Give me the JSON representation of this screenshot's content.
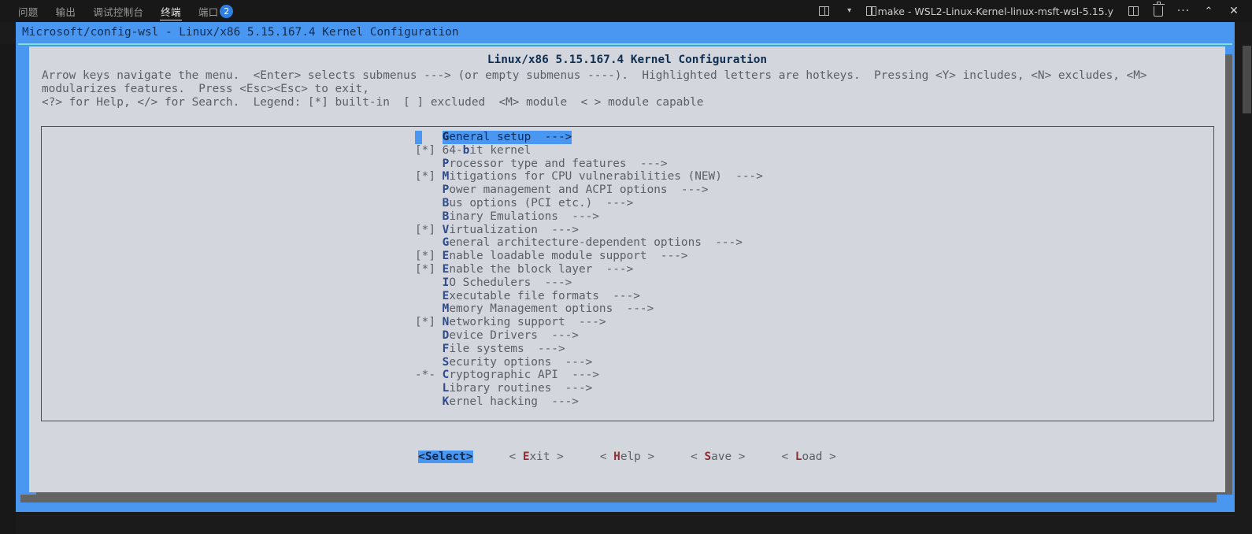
{
  "panel": {
    "tabs": [
      {
        "label": "问题",
        "name": "tab-problems",
        "active": false
      },
      {
        "label": "输出",
        "name": "tab-output",
        "active": false
      },
      {
        "label": "调试控制台",
        "name": "tab-debug-console",
        "active": false
      },
      {
        "label": "终端",
        "name": "tab-terminal",
        "active": true
      },
      {
        "label": "端口",
        "name": "tab-ports",
        "active": false
      }
    ],
    "ports_badge": "2",
    "terminal_name": "make - WSL2-Linux-Kernel-linux-msft-wsl-5.15.y",
    "actions": {
      "split_label": "",
      "chevron": "⌄",
      "dots": "···",
      "collapse": "⌃",
      "close": "✕"
    }
  },
  "dialog": {
    "window_title": "Microsoft/config-wsl - Linux/x86 5.15.167.4 Kernel Configuration",
    "heading": "Linux/x86 5.15.167.4 Kernel Configuration",
    "instructions": "Arrow keys navigate the menu.  <Enter> selects submenus ---> (or empty submenus ----).  Highlighted letters are hotkeys.  Pressing <Y> includes, <N> excludes, <M> modularizes features.  Press <Esc><Esc> to exit,\n<?> for Help, </> for Search.  Legend: [*] built-in  [ ] excluded  <M> module  < > module capable"
  },
  "menu": {
    "items": [
      {
        "mark": "    ",
        "hotkey": "G",
        "rest": "eneral setup",
        "arrow": "  --->",
        "selected": true
      },
      {
        "mark": "[*] ",
        "hotkey": "",
        "pre": "64-",
        "hotkey2": "b",
        "rest": "it kernel",
        "arrow": "",
        "selected": false
      },
      {
        "mark": "    ",
        "hotkey": "P",
        "rest": "rocessor type and features",
        "arrow": "  --->",
        "selected": false
      },
      {
        "mark": "[*] ",
        "hotkey": "M",
        "rest": "itigations for CPU vulnerabilities (NEW)",
        "arrow": "  --->",
        "selected": false
      },
      {
        "mark": "    ",
        "hotkey": "P",
        "rest": "ower management and ACPI options",
        "arrow": "  --->",
        "selected": false
      },
      {
        "mark": "    ",
        "hotkey": "B",
        "rest": "us options (PCI etc.)",
        "arrow": "  --->",
        "selected": false
      },
      {
        "mark": "    ",
        "hotkey": "B",
        "rest": "inary Emulations",
        "arrow": "  --->",
        "selected": false
      },
      {
        "mark": "[*] ",
        "hotkey": "V",
        "rest": "irtualization",
        "arrow": "  --->",
        "selected": false
      },
      {
        "mark": "    ",
        "hotkey": "G",
        "rest": "eneral architecture-dependent options",
        "arrow": "  --->",
        "selected": false
      },
      {
        "mark": "[*] ",
        "hotkey": "E",
        "rest": "nable loadable module support",
        "arrow": "  --->",
        "selected": false
      },
      {
        "mark": "[*] ",
        "hotkey": "E",
        "rest": "nable the block layer",
        "arrow": "  --->",
        "selected": false
      },
      {
        "mark": "    ",
        "hotkey": "I",
        "rest": "O Schedulers",
        "arrow": "  --->",
        "selected": false
      },
      {
        "mark": "    ",
        "hotkey": "E",
        "rest": "xecutable file formats",
        "arrow": "  --->",
        "selected": false
      },
      {
        "mark": "    ",
        "hotkey": "M",
        "rest": "emory Management options",
        "arrow": "  --->",
        "selected": false
      },
      {
        "mark": "[*] ",
        "hotkey": "N",
        "rest": "etworking support",
        "arrow": "  --->",
        "selected": false
      },
      {
        "mark": "    ",
        "hotkey": "D",
        "rest": "evice Drivers",
        "arrow": "  --->",
        "selected": false
      },
      {
        "mark": "    ",
        "hotkey": "F",
        "rest": "ile systems",
        "arrow": "  --->",
        "selected": false
      },
      {
        "mark": "    ",
        "hotkey": "S",
        "rest": "ecurity options",
        "arrow": "  --->",
        "selected": false
      },
      {
        "mark": "-*- ",
        "hotkey": "C",
        "rest": "ryptographic API",
        "arrow": "  --->",
        "selected": false
      },
      {
        "mark": "    ",
        "hotkey": "L",
        "rest": "ibrary routines",
        "arrow": "  --->",
        "selected": false
      },
      {
        "mark": "    ",
        "hotkey": "K",
        "rest": "ernel hacking",
        "arrow": "  --->",
        "selected": false
      }
    ]
  },
  "buttons": [
    {
      "name": "select-button",
      "pre": "<",
      "key": "S",
      "post": "elect>",
      "primary": true
    },
    {
      "name": "exit-button",
      "pre": "< ",
      "key": "E",
      "post": "xit >",
      "primary": false
    },
    {
      "name": "help-button",
      "pre": "< ",
      "key": "H",
      "post": "elp >",
      "primary": false
    },
    {
      "name": "save-button",
      "pre": "< ",
      "key": "S",
      "post": "ave >",
      "primary": false
    },
    {
      "name": "load-button",
      "pre": "< ",
      "key": "L",
      "post": "oad >",
      "primary": false
    }
  ],
  "colors": {
    "accent_blue": "#4a97f2",
    "dialog_bg": "#d3d6dc",
    "text_gray": "#5a6066",
    "hotkey_blue": "#2e4a8a",
    "hotkey_red": "#8d2f33",
    "teal_rule": "#7fe0d8"
  }
}
